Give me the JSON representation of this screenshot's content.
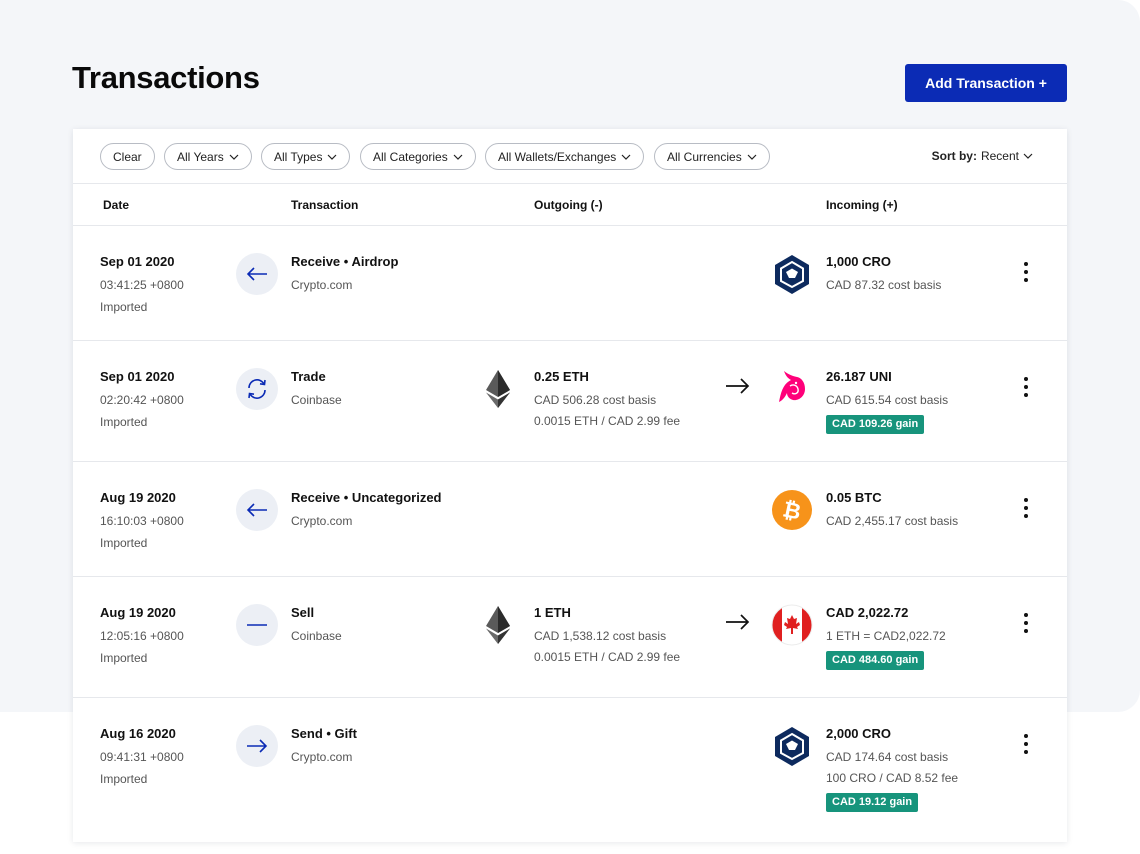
{
  "page": {
    "title": "Transactions",
    "add_button": "Add Transaction +"
  },
  "filters": {
    "clear": "Clear",
    "years": "All Years",
    "types": "All Types",
    "categories": "All Categories",
    "wallets": "All Wallets/Exchanges",
    "currencies": "All Currencies",
    "sort_label": "Sort by:",
    "sort_value": "Recent"
  },
  "columns": {
    "date": "Date",
    "transaction": "Transaction",
    "outgoing": "Outgoing (-)",
    "incoming": "Incoming (+)"
  },
  "colors": {
    "primary": "#0b2bb5",
    "gain": "#17947c",
    "row_icon_bg": "#eceff5"
  },
  "rows": [
    {
      "date": "Sep 01 2020",
      "time": "03:41:25 +0800",
      "origin": "Imported",
      "type_icon": "arrow-left-icon",
      "title": "Receive • Airdrop",
      "source": "Crypto.com",
      "incoming": {
        "icon": "cro-icon",
        "amount": "1,000 CRO",
        "cost": "CAD 87.32 cost basis"
      }
    },
    {
      "date": "Sep 01 2020",
      "time": "02:20:42 +0800",
      "origin": "Imported",
      "type_icon": "exchange-icon",
      "title": "Trade",
      "source": "Coinbase",
      "outgoing": {
        "icon": "eth-icon",
        "amount": "0.25 ETH",
        "cost": "CAD 506.28 cost basis",
        "fee": "0.0015 ETH / CAD 2.99 fee"
      },
      "incoming": {
        "icon": "uni-icon",
        "amount": "26.187 UNI",
        "cost": "CAD 615.54 cost basis",
        "gain": "CAD 109.26 gain"
      }
    },
    {
      "date": "Aug 19 2020",
      "time": "16:10:03 +0800",
      "origin": "Imported",
      "type_icon": "arrow-left-icon",
      "title": "Receive • Uncategorized",
      "source": "Crypto.com",
      "incoming": {
        "icon": "btc-icon",
        "amount": "0.05 BTC",
        "cost": "CAD 2,455.17 cost basis"
      }
    },
    {
      "date": "Aug 19 2020",
      "time": "12:05:16 +0800",
      "origin": "Imported",
      "type_icon": "minus-icon",
      "title": "Sell",
      "source": "Coinbase",
      "outgoing": {
        "icon": "eth-icon",
        "amount": "1 ETH",
        "cost": "CAD 1,538.12 cost basis",
        "fee": "0.0015 ETH / CAD 2.99 fee"
      },
      "incoming": {
        "icon": "canada-flag-icon",
        "amount": "CAD 2,022.72",
        "cost": "1 ETH = CAD2,022.72",
        "gain": "CAD 484.60 gain"
      }
    },
    {
      "date": "Aug 16 2020",
      "time": "09:41:31 +0800",
      "origin": "Imported",
      "type_icon": "arrow-right-icon",
      "title": "Send • Gift",
      "source": "Crypto.com",
      "incoming": {
        "icon": "cro-icon",
        "amount": "2,000 CRO",
        "cost": "CAD 174.64 cost basis",
        "fee": "100 CRO / CAD 8.52 fee",
        "gain": "CAD 19.12 gain"
      }
    }
  ]
}
